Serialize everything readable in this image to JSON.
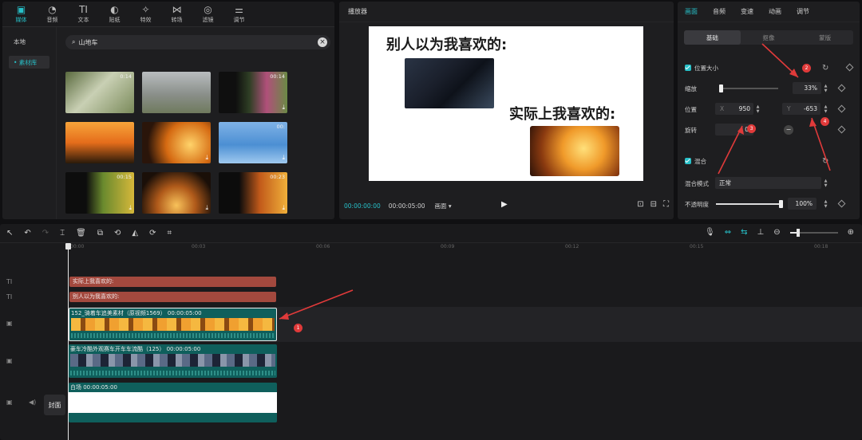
{
  "media_panel": {
    "tabs": [
      {
        "label": "媒体",
        "icon": "media-icon",
        "active": true
      },
      {
        "label": "音频",
        "icon": "audio-icon",
        "active": false
      },
      {
        "label": "文本",
        "icon": "text-icon",
        "active": false
      },
      {
        "label": "贴纸",
        "icon": "sticker-icon",
        "active": false
      },
      {
        "label": "特效",
        "icon": "effects-icon",
        "active": false
      },
      {
        "label": "转场",
        "icon": "transition-icon",
        "active": false
      },
      {
        "label": "滤镜",
        "icon": "filter-icon",
        "active": false
      },
      {
        "label": "调节",
        "icon": "adjust-icon",
        "active": false
      }
    ],
    "side": {
      "local": "本地",
      "library": "• 素材库"
    },
    "search": {
      "value": "山地车"
    },
    "thumbs": [
      {
        "duration": "0:14"
      },
      {
        "duration": ""
      },
      {
        "duration": "00:14"
      },
      {
        "duration": ""
      },
      {
        "duration": ""
      },
      {
        "duration": "00:"
      },
      {
        "duration": "00:15"
      },
      {
        "duration": ""
      },
      {
        "duration": "00:23"
      }
    ]
  },
  "player": {
    "title": "播放器",
    "caption_top": "别人以为我喜欢的:",
    "caption_bottom": "实际上我喜欢的:",
    "time_current": "00:00:00:00",
    "time_total": "00:00:05:00",
    "ratio_label": "画面 ▾"
  },
  "props": {
    "tabs": [
      {
        "label": "画面",
        "active": true
      },
      {
        "label": "音频",
        "active": false
      },
      {
        "label": "变速",
        "active": false
      },
      {
        "label": "动画",
        "active": false
      },
      {
        "label": "调节",
        "active": false
      }
    ],
    "subtabs": [
      {
        "label": "基础",
        "active": true
      },
      {
        "label": "抠像",
        "active": false
      },
      {
        "label": "蒙版",
        "active": false
      }
    ],
    "position_size": "位置大小",
    "scale_label": "缩放",
    "scale_value": "33%",
    "position_label": "位置",
    "pos_x_label": "X",
    "pos_x": "950",
    "pos_y_label": "Y",
    "pos_y": "-653",
    "rotate_label": "旋转",
    "rotate_value": "0",
    "blend_section": "混合",
    "blend_mode_label": "混合模式",
    "blend_mode_value": "正常",
    "opacity_label": "不透明度",
    "opacity_value": "100%",
    "scale_level": 0.33,
    "opacity_level": 1.0
  },
  "timeline": {
    "ruler": [
      "00:00",
      "00:03",
      "00:06",
      "00:09",
      "00:12",
      "00:15",
      "00:18"
    ],
    "text_clip_1": "实际上我喜欢的:",
    "text_clip_2": "别人以为我喜欢的:",
    "video_clip_1": "152_骑着车追美素材（原视频1569） 00:00:05:00",
    "video_clip_2": "豪车冷酷外观赛车开车车流酷（125） 00:00:05:00",
    "white_clip": "白场 00:00:05:00",
    "cover_label": "封面"
  },
  "annotations": [
    "1",
    "2",
    "3",
    "4"
  ],
  "colors": {
    "accent": "#27c0c8",
    "text_clip": "#a3493e",
    "video_clip": "#0f5f5c",
    "marker": "#e03a3a"
  }
}
